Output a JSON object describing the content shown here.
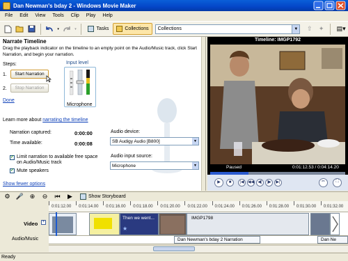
{
  "window": {
    "title": "Dan Newman's bday 2 - Windows Movie Maker"
  },
  "menu": [
    "File",
    "Edit",
    "View",
    "Tools",
    "Clip",
    "Play",
    "Help"
  ],
  "toolbar": {
    "tasks_label": "Tasks",
    "collections_label": "Collections",
    "collections_select": "Collections"
  },
  "narrate": {
    "heading": "Narrate Timeline",
    "intro": "Drag the playback indicator on the timeline to an empty point on the Audio/Music track, click Start Narration, and begin your narration.",
    "steps_label": "Steps:",
    "step1": "1.",
    "step2": "2.",
    "start_button": "Start Narration",
    "stop_button": "Stop Narration",
    "done_link": "Done",
    "input_level_label": "Input level",
    "microphone_label": "Microphone",
    "learn_prefix": "Learn more about ",
    "learn_link": "narrating the timeline",
    "captured_label": "Narration captured:",
    "captured_value": "0:00:00",
    "available_label": "Time available:",
    "available_value": "0:00:08",
    "limit_label": "Limit narration to available free space on Audio/Music track",
    "limit_checked": true,
    "mute_label": "Mute speakers",
    "mute_checked": true,
    "device_label": "Audio device:",
    "device_value": "SB Audigy Audio [B800]",
    "source_label": "Audio input source:",
    "source_value": "Microphone",
    "fewer_options_link": "Show fewer options"
  },
  "preview": {
    "title": "Timeline: IMGP1792",
    "status": "Paused",
    "time": "0:01:12.53 / 0:04:14.20",
    "progress": 0.286
  },
  "timeline": {
    "show_storyboard": "Show Storyboard",
    "ticks": [
      "0:01:12.00",
      "0:01:14.00",
      "0:01:16.00",
      "0:01:18.00",
      "0:01:20.00",
      "0:01:22.00",
      "0:01:24.00",
      "0:01:26.00",
      "0:01:28.00",
      "0:01:30.00",
      "0:01:32.00"
    ],
    "video_label": "Video",
    "audio_label": "Audio/Music",
    "clip_title_text": "Then we went...",
    "clip_image_name": "IMGP1798",
    "audio_clip1": "Dan Newman's bday 2 Narration",
    "audio_clip2": "Dan Ne"
  },
  "status": {
    "text": "Ready"
  },
  "icons": [
    "new-project-icon",
    "open-icon",
    "save-icon",
    "undo-icon",
    "redo-icon",
    "tasks-icon",
    "collections-icon",
    "up-folder-icon",
    "new-folder-icon",
    "views-icon",
    "play-icon",
    "stop-icon",
    "previous-frame-icon",
    "next-frame-icon",
    "split-icon",
    "fullscreen-icon",
    "microphone-icon",
    "zoom-in-icon",
    "zoom-out-icon",
    "rewind-icon"
  ]
}
